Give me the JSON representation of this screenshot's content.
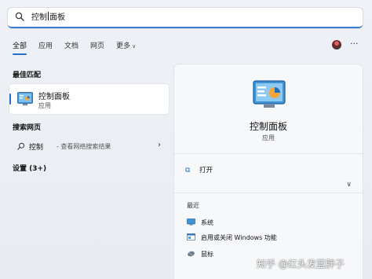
{
  "search": {
    "value_before_caret": "控制",
    "value_after_caret": "面板"
  },
  "tabs": [
    {
      "label": "全部",
      "active": true
    },
    {
      "label": "应用"
    },
    {
      "label": "文档"
    },
    {
      "label": "网页"
    },
    {
      "label": "更多"
    }
  ],
  "more_menu": "···",
  "best_match": {
    "section_title": "最佳匹配",
    "name": "控制面板",
    "type": "应用"
  },
  "web_search": {
    "section_title": "搜索网页",
    "query": "控制",
    "hint": "- 查看网络搜索结果"
  },
  "settings": {
    "section_title": "设置 (3+)"
  },
  "details": {
    "title": "控制面板",
    "type": "应用",
    "open_label": "打开",
    "recent_title": "最近",
    "recent_items": [
      {
        "label": "系统",
        "icon": "system-icon"
      },
      {
        "label": "启用或关闭 Windows 功能",
        "icon": "windows-features-icon"
      },
      {
        "label": "鼠标",
        "icon": "mouse-icon"
      }
    ]
  },
  "watermark": "知乎 @红头发蓝胖子",
  "colors": {
    "accent": "#2b6fc9",
    "pane_background": "#f7f8fa"
  }
}
